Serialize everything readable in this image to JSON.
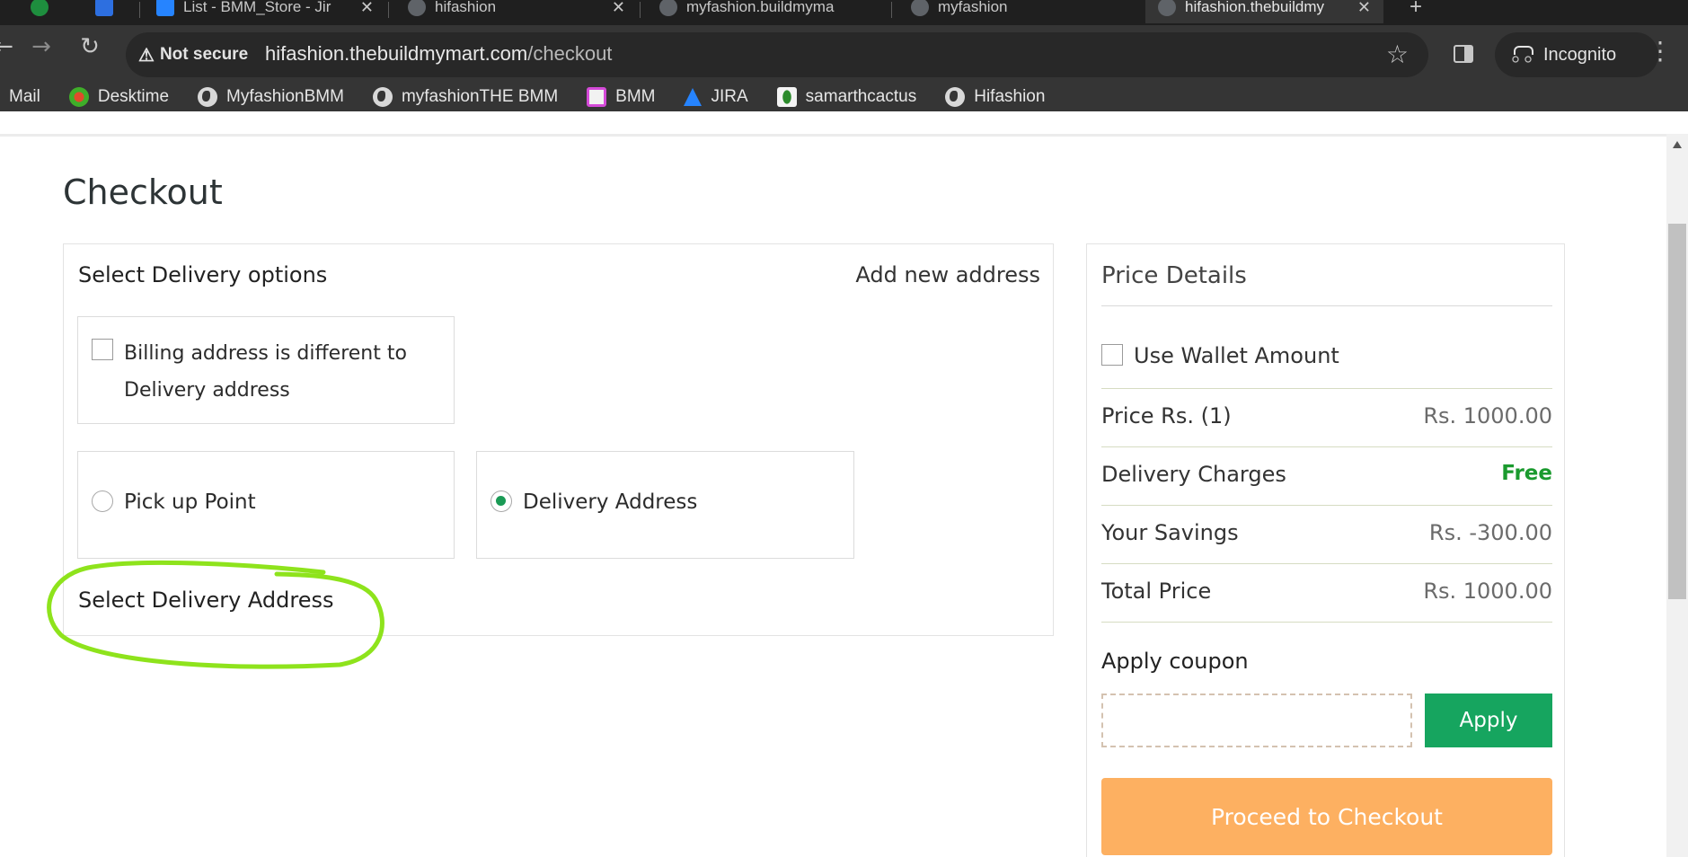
{
  "browser": {
    "tabs": [
      {
        "title": ""
      },
      {
        "title": ""
      },
      {
        "title": "List - BMM_Store - Jir"
      },
      {
        "title": "hifashion"
      },
      {
        "title": "myfashion.buildmyma"
      },
      {
        "title": "myfashion"
      },
      {
        "title": "hifashion.thebuildmy"
      }
    ],
    "security_label": "Not secure",
    "url_host": "hifashion.thebuildmymart.com",
    "url_path": "/checkout",
    "incognito_label": "Incognito",
    "bookmarks": [
      {
        "label": "Mail",
        "icon": "mail-icon"
      },
      {
        "label": "Desktime",
        "icon": "desktime-icon"
      },
      {
        "label": "MyfashionBMM",
        "icon": "globe-icon"
      },
      {
        "label": "myfashionTHE BMM",
        "icon": "globe-icon"
      },
      {
        "label": "BMM",
        "icon": "bmm-icon"
      },
      {
        "label": "JIRA",
        "icon": "jira-icon"
      },
      {
        "label": "samarthcactus",
        "icon": "cactus-icon"
      },
      {
        "label": "Hifashion",
        "icon": "globe-icon"
      }
    ]
  },
  "page": {
    "title": "Checkout",
    "delivery": {
      "heading": "Select Delivery options",
      "add_new_address": "Add new address",
      "billing_different": "Billing address is different to Delivery address",
      "pickup_point": "Pick up Point",
      "delivery_address": "Delivery Address",
      "selected_option": "Delivery Address",
      "select_address_heading": "Select Delivery Address"
    },
    "price_details": {
      "title": "Price Details",
      "use_wallet": "Use Wallet Amount",
      "rows": [
        {
          "label": "Price Rs. (1)",
          "value": "Rs. 1000.00"
        },
        {
          "label": "Delivery Charges",
          "value": "Free"
        },
        {
          "label": "Your Savings",
          "value": "Rs. -300.00"
        },
        {
          "label": "Total Price",
          "value": "Rs. 1000.00"
        }
      ],
      "coupon_title": "Apply coupon",
      "coupon_value": "",
      "apply_label": "Apply",
      "proceed_label": "Proceed to Checkout"
    }
  },
  "colors": {
    "accent_green": "#16a55f",
    "free_green": "#1a9a2e",
    "proceed_orange": "#fdb061",
    "annotation_lime": "#8ee31c"
  }
}
